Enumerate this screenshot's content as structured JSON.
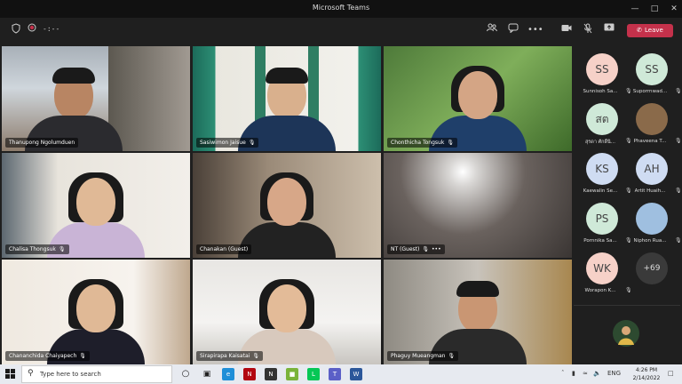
{
  "window": {
    "title": "Microsoft Teams"
  },
  "toolbar": {
    "timer": "-:--",
    "leave_label": "Leave"
  },
  "tiles": [
    {
      "name": "Thanupong Ngolumduen"
    },
    {
      "name": "Sasiwimon Jaisue"
    },
    {
      "name": "Chonthicha Tongsuk"
    },
    {
      "name": "Chalisa Thongsuk"
    },
    {
      "name": "Chanakan (Guest)"
    },
    {
      "name": "NT (Guest)"
    },
    {
      "name": "Chananchida Chaiyapech"
    },
    {
      "name": "Sirapirapa Kaisatai"
    },
    {
      "name": "Phaguy Mueangman"
    }
  ],
  "roster": [
    {
      "initials": "SS",
      "name": "Sunnisoh Sa...",
      "color": "#f6d1c8"
    },
    {
      "initials": "SS",
      "name": "Suporrnwad...",
      "color": "#cfe9d8"
    },
    {
      "initials": "สต",
      "name": "สุรดา ศักดิ์นิ...",
      "color": "#cfe9d8"
    },
    {
      "initials": "",
      "name": "Phaveena T...",
      "color": "#8a6a4a"
    },
    {
      "initials": "KS",
      "name": "Kaewalin Se...",
      "color": "#cfdcf2"
    },
    {
      "initials": "AH",
      "name": "Artit Huaih...",
      "color": "#cfdcf2"
    },
    {
      "initials": "PS",
      "name": "Pornnika Sa...",
      "color": "#cfe9d8"
    },
    {
      "initials": "",
      "name": "Niphon Rua...",
      "color": "#9fbfe0"
    },
    {
      "initials": "WK",
      "name": "Worapon K...",
      "color": "#f6d1c8"
    },
    {
      "initials": "+69",
      "name": "",
      "color": "#3a3a3a"
    }
  ],
  "taskbar": {
    "search_placeholder": "Type here to search",
    "lang": "ENG",
    "time": "4:26 PM",
    "date": "2/14/2022"
  }
}
